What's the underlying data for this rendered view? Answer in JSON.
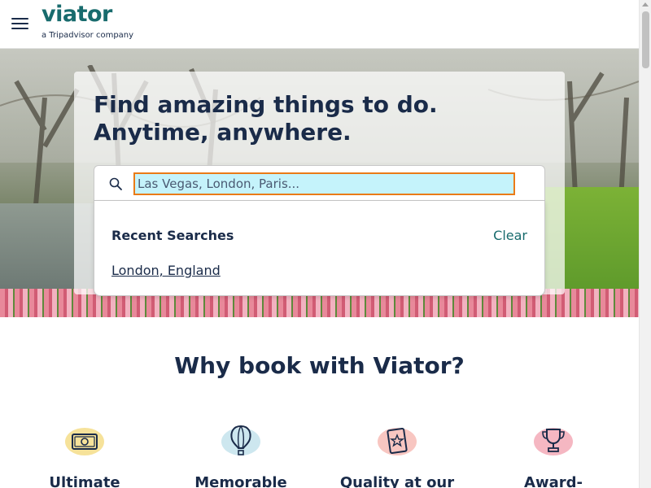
{
  "header": {
    "logo": "viator",
    "logo_sub": "a Tripadvisor company",
    "menu_icon": "hamburger-menu-icon"
  },
  "hero": {
    "headline_line1": "Find amazing things to do.",
    "headline_line2": "Anytime, anywhere.",
    "search": {
      "placeholder": "Las Vegas, London, Paris...",
      "value": "",
      "icon": "search-icon"
    },
    "recent": {
      "title": "Recent Searches",
      "clear_label": "Clear",
      "items": [
        "London, England"
      ]
    }
  },
  "why": {
    "title": "Why book with Viator?",
    "features": [
      {
        "label": "Ultimate",
        "icon": "money-icon",
        "blob_color": "#f6e29a"
      },
      {
        "label": "Memorable",
        "icon": "hot-air-balloon-icon",
        "blob_color": "#cde7ef"
      },
      {
        "label": "Quality at our",
        "icon": "star-badge-icon",
        "blob_color": "#f8c6c1"
      },
      {
        "label": "Award-",
        "icon": "trophy-icon",
        "blob_color": "#f5b7c2"
      }
    ]
  },
  "colors": {
    "brand": "#186b6d",
    "text": "#1a2b49",
    "focus_outline": "#ea7b17",
    "input_focus_bg": "#c5f3fb"
  }
}
